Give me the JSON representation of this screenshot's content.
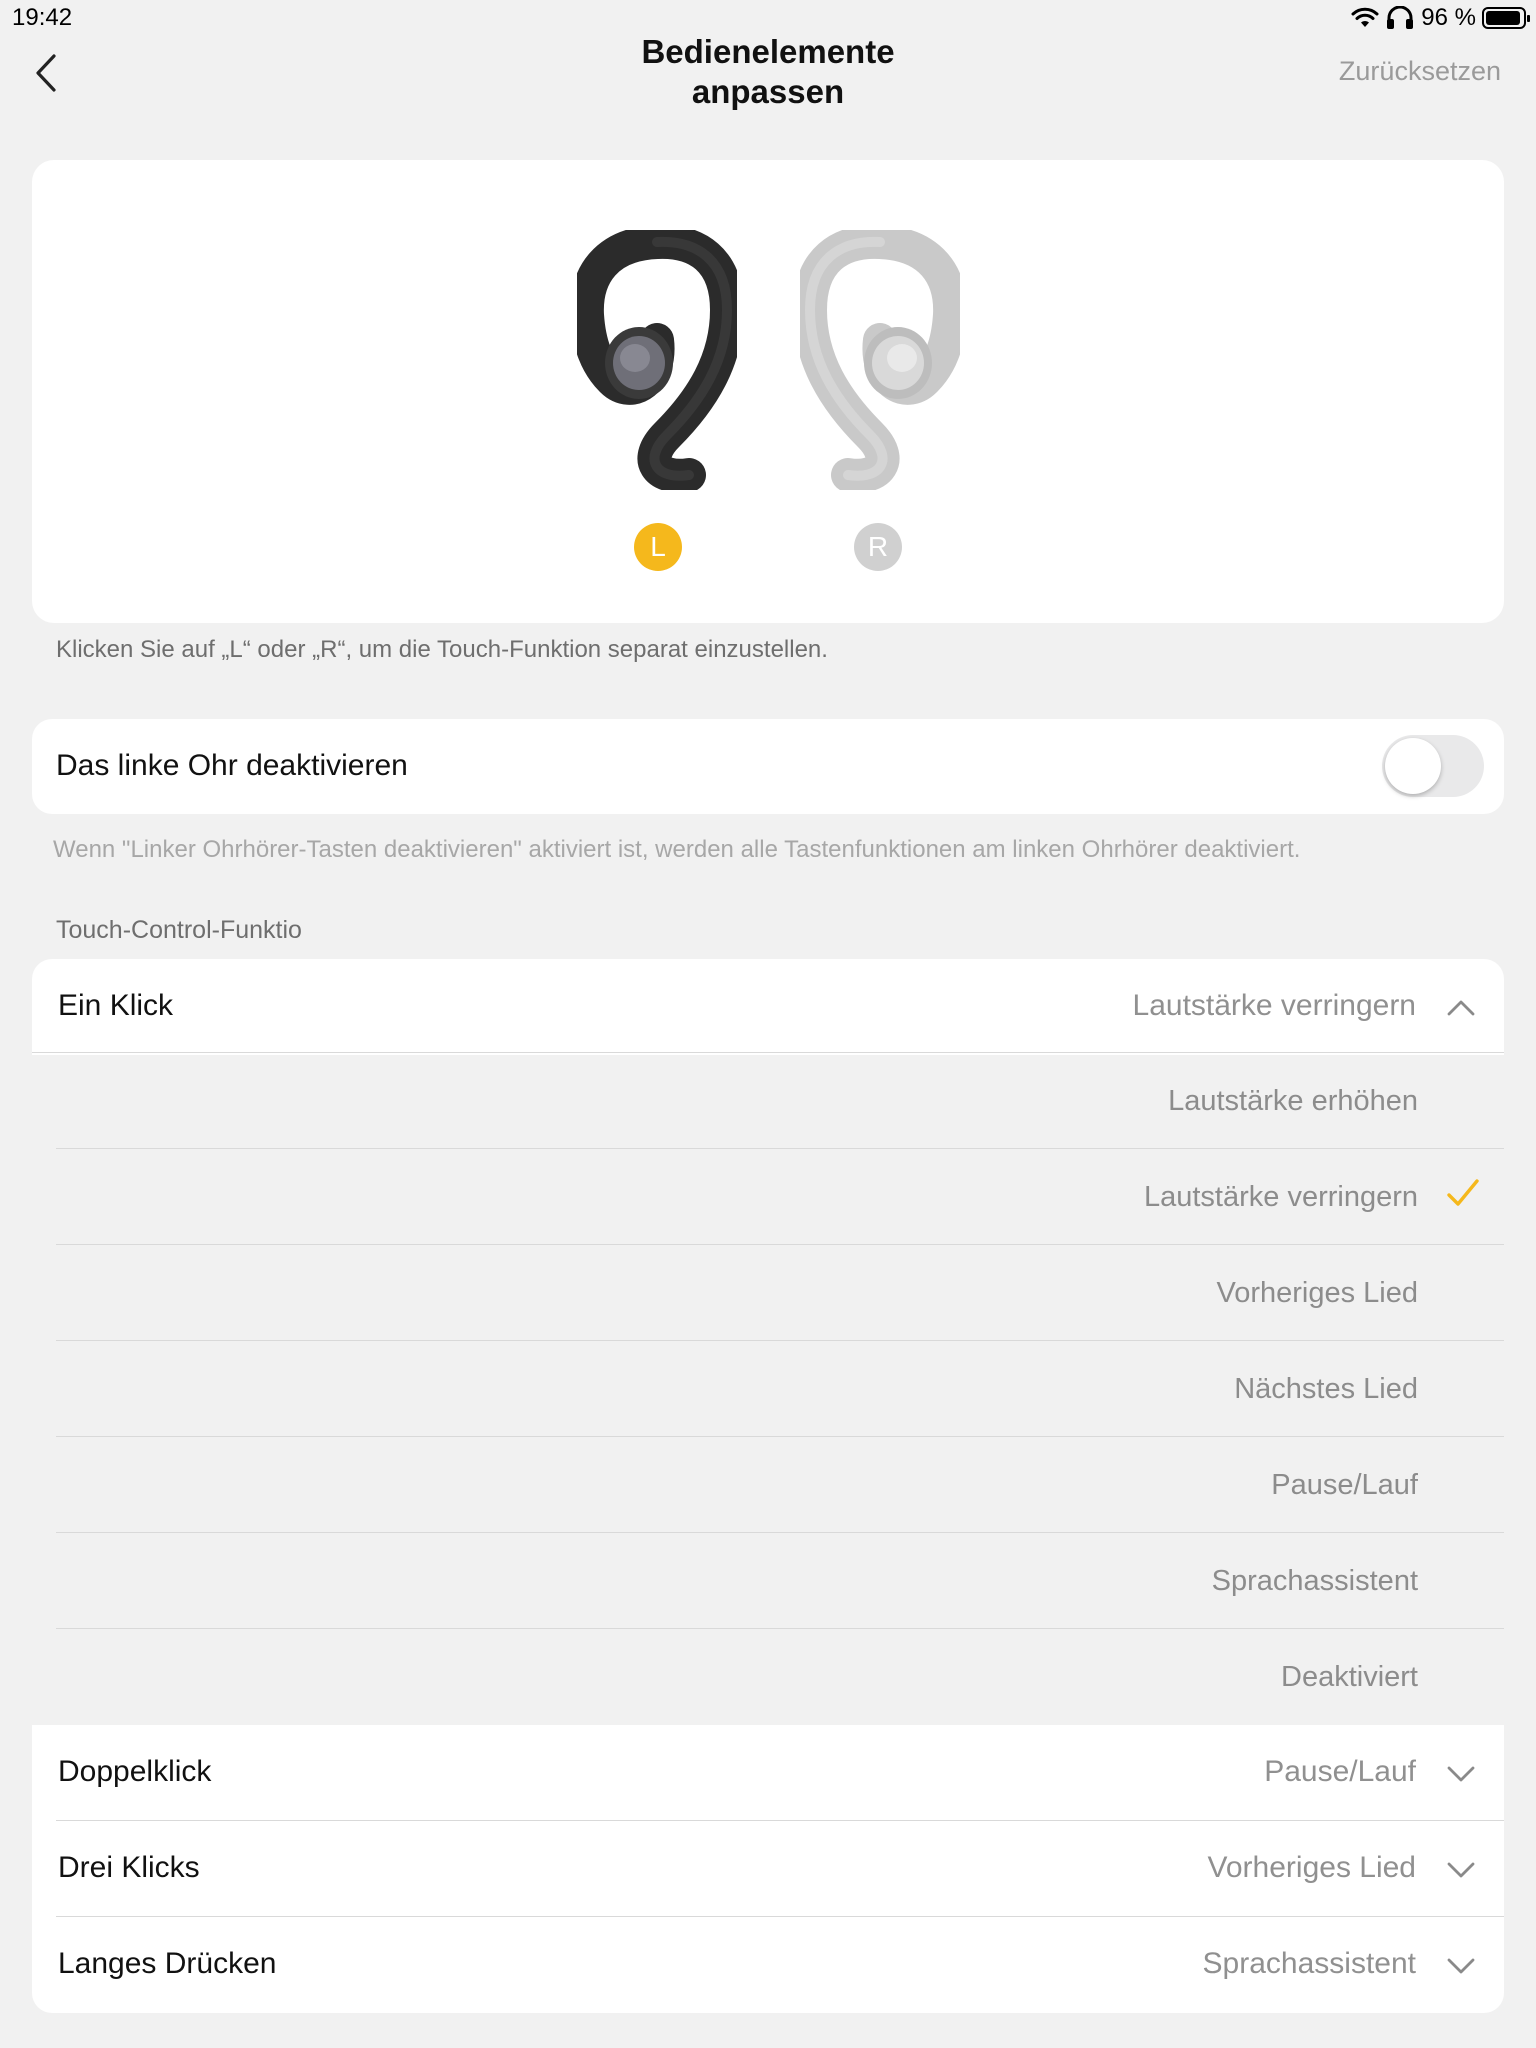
{
  "status": {
    "time": "19:42",
    "battery": "96 %"
  },
  "header": {
    "title_line1": "Bedienelemente",
    "title_line2": "anpassen",
    "reset": "Zurücksetzen"
  },
  "earbuds": {
    "left_label": "L",
    "right_label": "R",
    "hint": "Klicken Sie auf „L“ oder „R“, um die Touch-Funktion separat einzustellen."
  },
  "disable_left": {
    "label": "Das linke Ohr deaktivieren",
    "enabled": false,
    "note": "Wenn \"Linker Ohrhörer-Tasten deaktivieren\" aktiviert ist, werden alle Tastenfunktionen am linken Ohrhörer deaktiviert."
  },
  "touch_controls": {
    "section_title": "Touch-Control-Funktio",
    "single_click": {
      "label": "Ein Klick",
      "value": "Lautstärke verringern",
      "options": [
        "Lautstärke erhöhen",
        "Lautstärke verringern",
        "Vorheriges Lied",
        "Nächstes Lied",
        "Pause/Lauf",
        "Sprachassistent",
        "Deaktiviert"
      ],
      "selected_index": 1
    },
    "double_click": {
      "label": "Doppelklick",
      "value": "Pause/Lauf"
    },
    "triple_click": {
      "label": "Drei Klicks",
      "value": "Vorheriges Lied"
    },
    "long_press": {
      "label": "Langes Drücken",
      "value": "Sprachassistent"
    }
  },
  "colors": {
    "accent": "#F5B81C",
    "inactive_badge": "#D0D0D0",
    "background": "#F1F1F1"
  }
}
